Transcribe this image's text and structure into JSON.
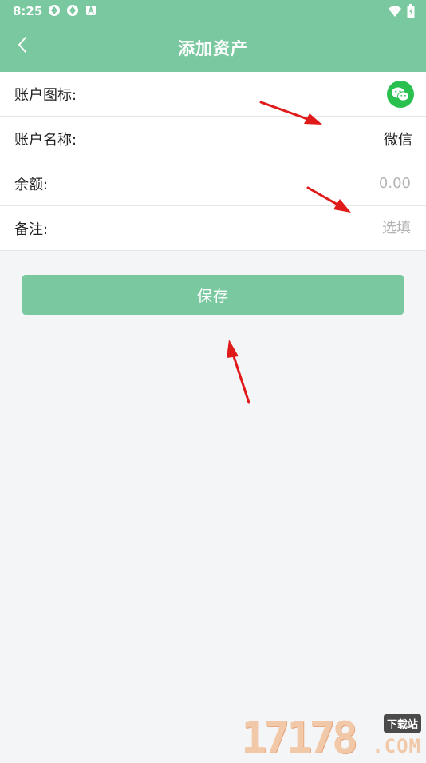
{
  "status_bar": {
    "time": "8:25",
    "left_icons": [
      "sync-icon",
      "sync-icon",
      "a-badge-icon"
    ],
    "right_icons": [
      "wifi-icon",
      "battery-icon"
    ]
  },
  "app_bar": {
    "title": "添加资产",
    "background": "#7ac8a0"
  },
  "form": {
    "rows": [
      {
        "label": "账户图标:",
        "value_icon": "wechat-icon"
      },
      {
        "label": "账户名称:",
        "value": "微信"
      },
      {
        "label": "余额:",
        "placeholder": "0.00",
        "value": ""
      },
      {
        "label": "备注:",
        "placeholder": "选填",
        "value": ""
      }
    ]
  },
  "save_button": {
    "label": "保存"
  },
  "watermark": {
    "digits": "17178",
    "tag": "下载站",
    "suffix": ".COM"
  },
  "colors": {
    "accent": "#7ac8a0",
    "wechat": "#2ac04f",
    "annotation_arrow": "#e01919",
    "page_bg": "#f4f5f7"
  }
}
